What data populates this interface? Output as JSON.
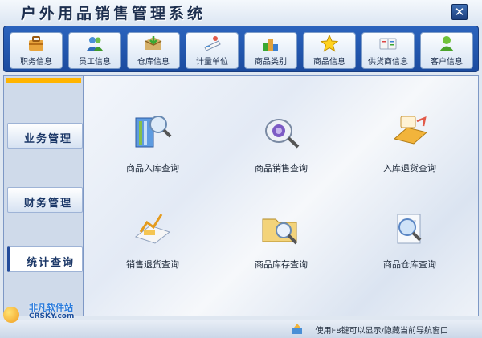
{
  "window": {
    "title": "户外用品销售管理系统"
  },
  "toolbar": {
    "buttons": [
      {
        "label": "职务信息",
        "icon": "briefcase-icon"
      },
      {
        "label": "员工信息",
        "icon": "users-icon"
      },
      {
        "label": "仓库信息",
        "icon": "warehouse-box-icon"
      },
      {
        "label": "计量单位",
        "icon": "scale-icon"
      },
      {
        "label": "商品类别",
        "icon": "category-blocks-icon"
      },
      {
        "label": "商品信息",
        "icon": "star-icon"
      },
      {
        "label": "供货商信息",
        "icon": "supplier-book-icon"
      },
      {
        "label": "客户信息",
        "icon": "customer-icon"
      }
    ]
  },
  "sidebar": {
    "items": [
      {
        "label": "业务管理",
        "active": false
      },
      {
        "label": "财务管理",
        "active": false
      },
      {
        "label": "统计查询",
        "active": true
      }
    ]
  },
  "main": {
    "items": [
      {
        "label": "商品入库查询",
        "icon": "stock-in-query-icon"
      },
      {
        "label": "商品销售查询",
        "icon": "sales-query-icon"
      },
      {
        "label": "入库退货查询",
        "icon": "stock-return-query-icon"
      },
      {
        "label": "销售退货查询",
        "icon": "sales-return-query-icon"
      },
      {
        "label": "商品库存查询",
        "icon": "inventory-query-icon"
      },
      {
        "label": "商品仓库查询",
        "icon": "warehouse-query-icon"
      }
    ]
  },
  "status": {
    "hint": "使用F8键可以显示/隐藏当前导航窗口"
  },
  "watermark": {
    "line1": "非凡软件站",
    "line2": "CRSKY.com"
  },
  "colors": {
    "toolbar": "#2b63bd",
    "accent": "#ffb400",
    "sidebar_text": "#1b3767"
  }
}
